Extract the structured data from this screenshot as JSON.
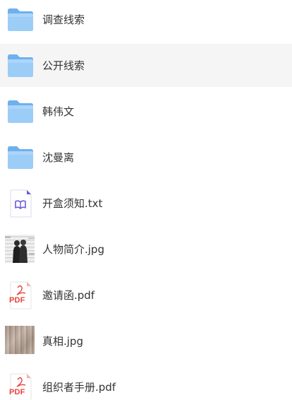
{
  "files": [
    {
      "name": "调查线索",
      "type": "folder-icon",
      "selected": false
    },
    {
      "name": "公开线索",
      "type": "folder-icon",
      "selected": true
    },
    {
      "name": "韩伟文",
      "type": "folder-icon",
      "selected": false
    },
    {
      "name": "沈曼离",
      "type": "folder-icon",
      "selected": false
    },
    {
      "name": "开盒须知.txt",
      "type": "txt-file-icon",
      "selected": false
    },
    {
      "name": "人物简介.jpg",
      "type": "image-thumbnail",
      "selected": false
    },
    {
      "name": "邀请函.pdf",
      "type": "pdf-file-icon",
      "selected": false,
      "icon_label": "PDF"
    },
    {
      "name": "真相.jpg",
      "type": "image-thumbnail",
      "selected": false
    },
    {
      "name": "组织者手册.pdf",
      "type": "pdf-file-icon",
      "selected": false,
      "icon_label": "PDF"
    }
  ],
  "colors": {
    "folder": "#8cc4f5",
    "folder_tab": "#6fb0ee",
    "pdf_red": "#e8403a",
    "txt_purple": "#6a5ae0",
    "selected_row": "#f5f5f5",
    "text": "#333333"
  }
}
